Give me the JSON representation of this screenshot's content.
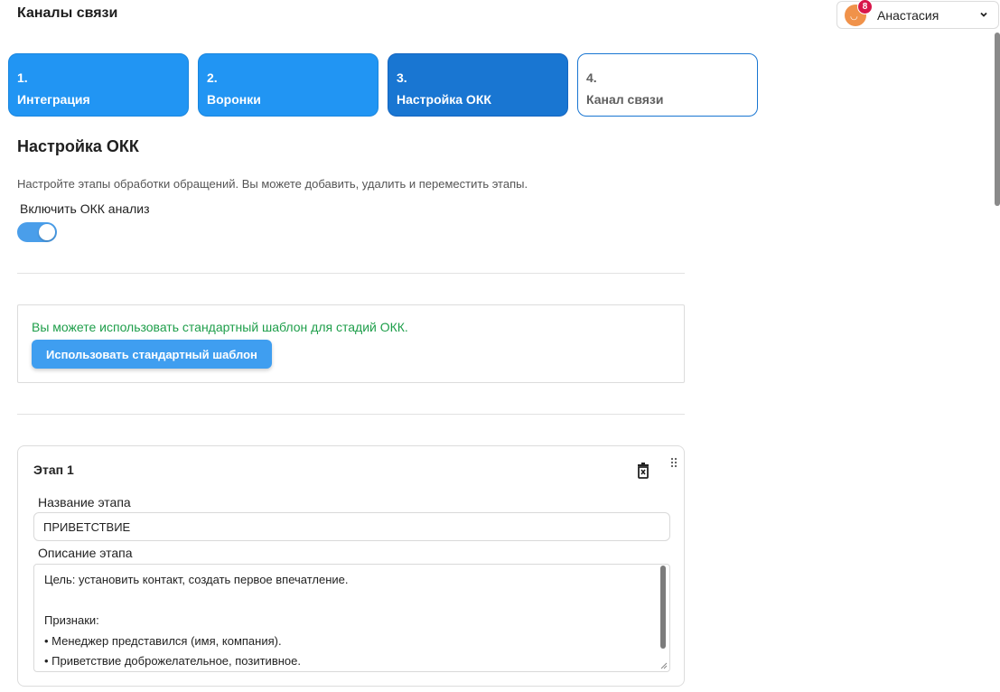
{
  "header": {
    "title": "Каналы связи"
  },
  "user": {
    "name": "Анастасия",
    "notifications": "8",
    "avatar_icon": "avatar-icon",
    "chevron_icon": "chevron-down-icon"
  },
  "wizard": {
    "steps": [
      {
        "number": "1.",
        "label": "Интеграция",
        "state": "done"
      },
      {
        "number": "2.",
        "label": "Воронки",
        "state": "done"
      },
      {
        "number": "3.",
        "label": "Настройка ОКК",
        "state": "current"
      },
      {
        "number": "4.",
        "label": "Канал связи",
        "state": "pending"
      }
    ]
  },
  "section": {
    "title": "Настройка ОКК",
    "description": "Настройте этапы обработки обращений. Вы можете добавить, удалить и переместить этапы.",
    "toggle_label": "Включить ОКК анализ",
    "toggle_on": true
  },
  "template": {
    "hint": "Вы можете использовать стандартный шаблон для стадий ОКК.",
    "button_label": "Использовать стандартный шаблон"
  },
  "stage": {
    "title": "Этап 1",
    "name_label": "Название этапа",
    "name_value": "ПРИВЕТСТВИЕ",
    "desc_label": "Описание этапа",
    "desc_value": "Цель: установить контакт, создать первое впечатление.\n\nПризнаки:\n• Менеджер представился (имя, компания).\n• Приветствие доброжелательное, позитивное.",
    "delete_icon": "trash-icon",
    "drag_icon": "drag-handle-icon"
  },
  "colors": {
    "accent": "#2195f3",
    "accent_dark": "#1976d2",
    "success_text": "#1e9e4a",
    "badge": "#d8164a"
  }
}
